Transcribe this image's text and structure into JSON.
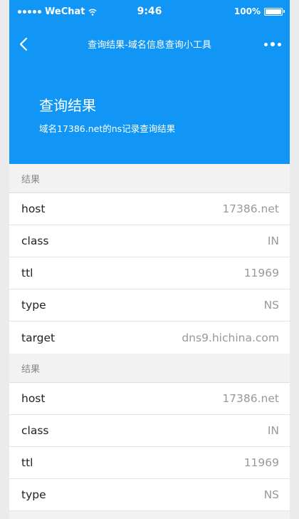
{
  "status_bar": {
    "carrier": "WeChat",
    "time": "9:46",
    "battery": "100%"
  },
  "nav": {
    "title": "查询结果-域名信息查询小工具"
  },
  "header": {
    "title": "查询结果",
    "subtitle": "域名17386.net的ns记录查询结果"
  },
  "sections": [
    {
      "label": "结果",
      "rows": [
        {
          "key": "host",
          "value": "17386.net"
        },
        {
          "key": "class",
          "value": "IN"
        },
        {
          "key": "ttl",
          "value": "11969"
        },
        {
          "key": "type",
          "value": "NS"
        },
        {
          "key": "target",
          "value": "dns9.hichina.com"
        }
      ]
    },
    {
      "label": "结果",
      "rows": [
        {
          "key": "host",
          "value": "17386.net"
        },
        {
          "key": "class",
          "value": "IN"
        },
        {
          "key": "ttl",
          "value": "11969"
        },
        {
          "key": "type",
          "value": "NS"
        }
      ]
    }
  ],
  "colors": {
    "accent": "#1296f5",
    "background": "#f2f2f2"
  }
}
